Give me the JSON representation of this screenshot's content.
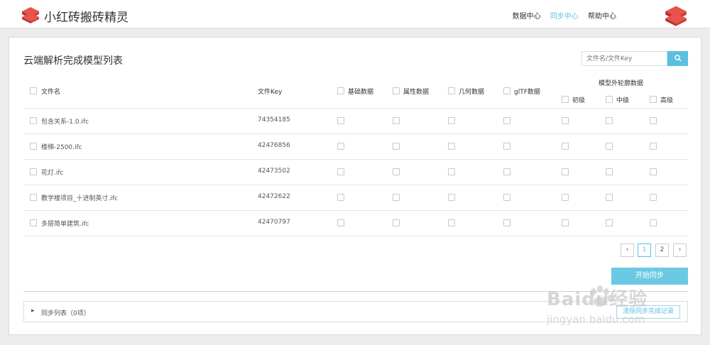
{
  "app": {
    "title": "小红砖搬砖精灵"
  },
  "nav": {
    "items": [
      "数据中心",
      "同步中心",
      "帮助中心"
    ],
    "active_index": 1
  },
  "colors": {
    "accent": "#5bc0de",
    "brand": "#d9534f"
  },
  "panel": {
    "title": "云端解析完成模型列表"
  },
  "search": {
    "placeholder": "文件名/文件Key",
    "icon": "search-icon"
  },
  "table": {
    "columns": {
      "filename": "文件名",
      "filekey": "文件Key",
      "basic": "基础数据",
      "attr": "属性数据",
      "geom": "几何数据",
      "gltf": "glTF数据",
      "outline_group": "模型外轮廓数据",
      "outline_levels": [
        "初级",
        "中级",
        "高级"
      ]
    },
    "rows": [
      {
        "name": "包含关系-1.0.ifc",
        "key": "74354185"
      },
      {
        "name": "楼梯-2500.ifc",
        "key": "42476856"
      },
      {
        "name": "花灯.ifc",
        "key": "42473502"
      },
      {
        "name": "教学楼项目_十进制英寸.ifc",
        "key": "42472622"
      },
      {
        "name": "多层简单建筑.ifc",
        "key": "42470797"
      }
    ]
  },
  "pagination": {
    "prev": "‹",
    "pages": [
      "1",
      "2"
    ],
    "current": "1",
    "next": "›"
  },
  "actions": {
    "start_sync": "开始同步"
  },
  "sync_list": {
    "label": "同步列表（0项）",
    "clear_label": "清除同步完成记录"
  },
  "watermark": {
    "brand": "Baidu经验",
    "url": "jingyan.baidu.com"
  }
}
